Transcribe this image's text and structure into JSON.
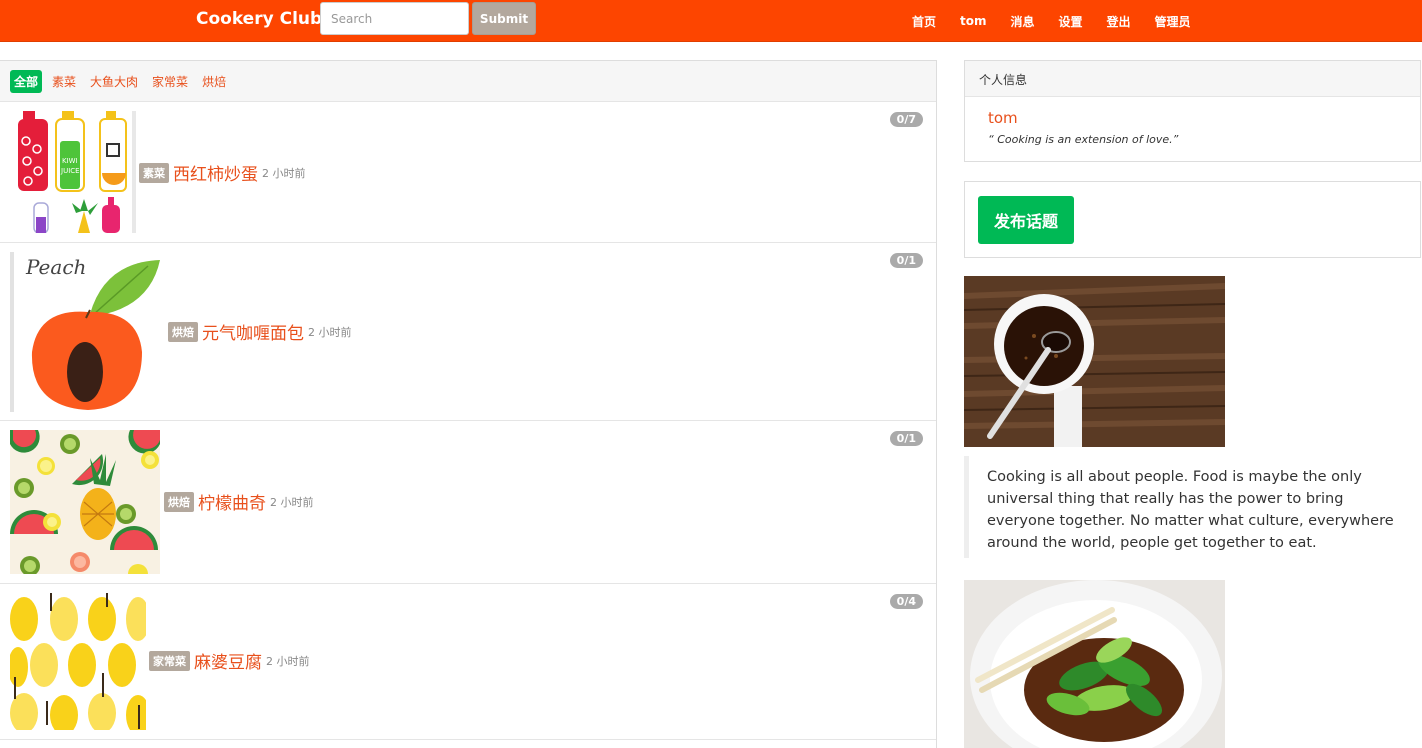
{
  "navbar": {
    "brand": "Cookery Club",
    "search_placeholder": "Search",
    "submit_label": "Submit",
    "links": [
      "首页",
      "tom",
      "消息",
      "设置",
      "登出",
      "管理员"
    ],
    "bg_color": "#fd4500"
  },
  "tabs": [
    "全部",
    "素菜",
    "大鱼大肉",
    "家常菜",
    "烘焙"
  ],
  "active_tab": "全部",
  "topics": [
    {
      "tag": "素菜",
      "title": "西红柿炒蛋",
      "time": "2 小时前",
      "count": "0/7",
      "image": "juice-bottles-illustration"
    },
    {
      "tag": "烘焙",
      "title": "元气咖喱面包",
      "time": "2 小时前",
      "count": "0/1",
      "image": "peach-illustration"
    },
    {
      "tag": "烘焙",
      "title": "柠檬曲奇",
      "time": "2 小时前",
      "count": "0/1",
      "image": "fruit-pattern-illustration"
    },
    {
      "tag": "家常菜",
      "title": "麻婆豆腐",
      "time": "2 小时前",
      "count": "0/4",
      "image": "yellow-trees-pattern"
    }
  ],
  "profile": {
    "header": "个人信息",
    "username": "tom",
    "signature": "“ Cooking is an extension of love.”"
  },
  "publish_label": "发布话题",
  "quote": "Cooking is all about people. Food is maybe the only universal thing that really has the power to bring everyone together. No matter what culture, everywhere around the world, people get together to eat.",
  "colors": {
    "accent_orange": "#e8501c",
    "green": "#00b955",
    "tag_gray": "#b3a89d"
  }
}
